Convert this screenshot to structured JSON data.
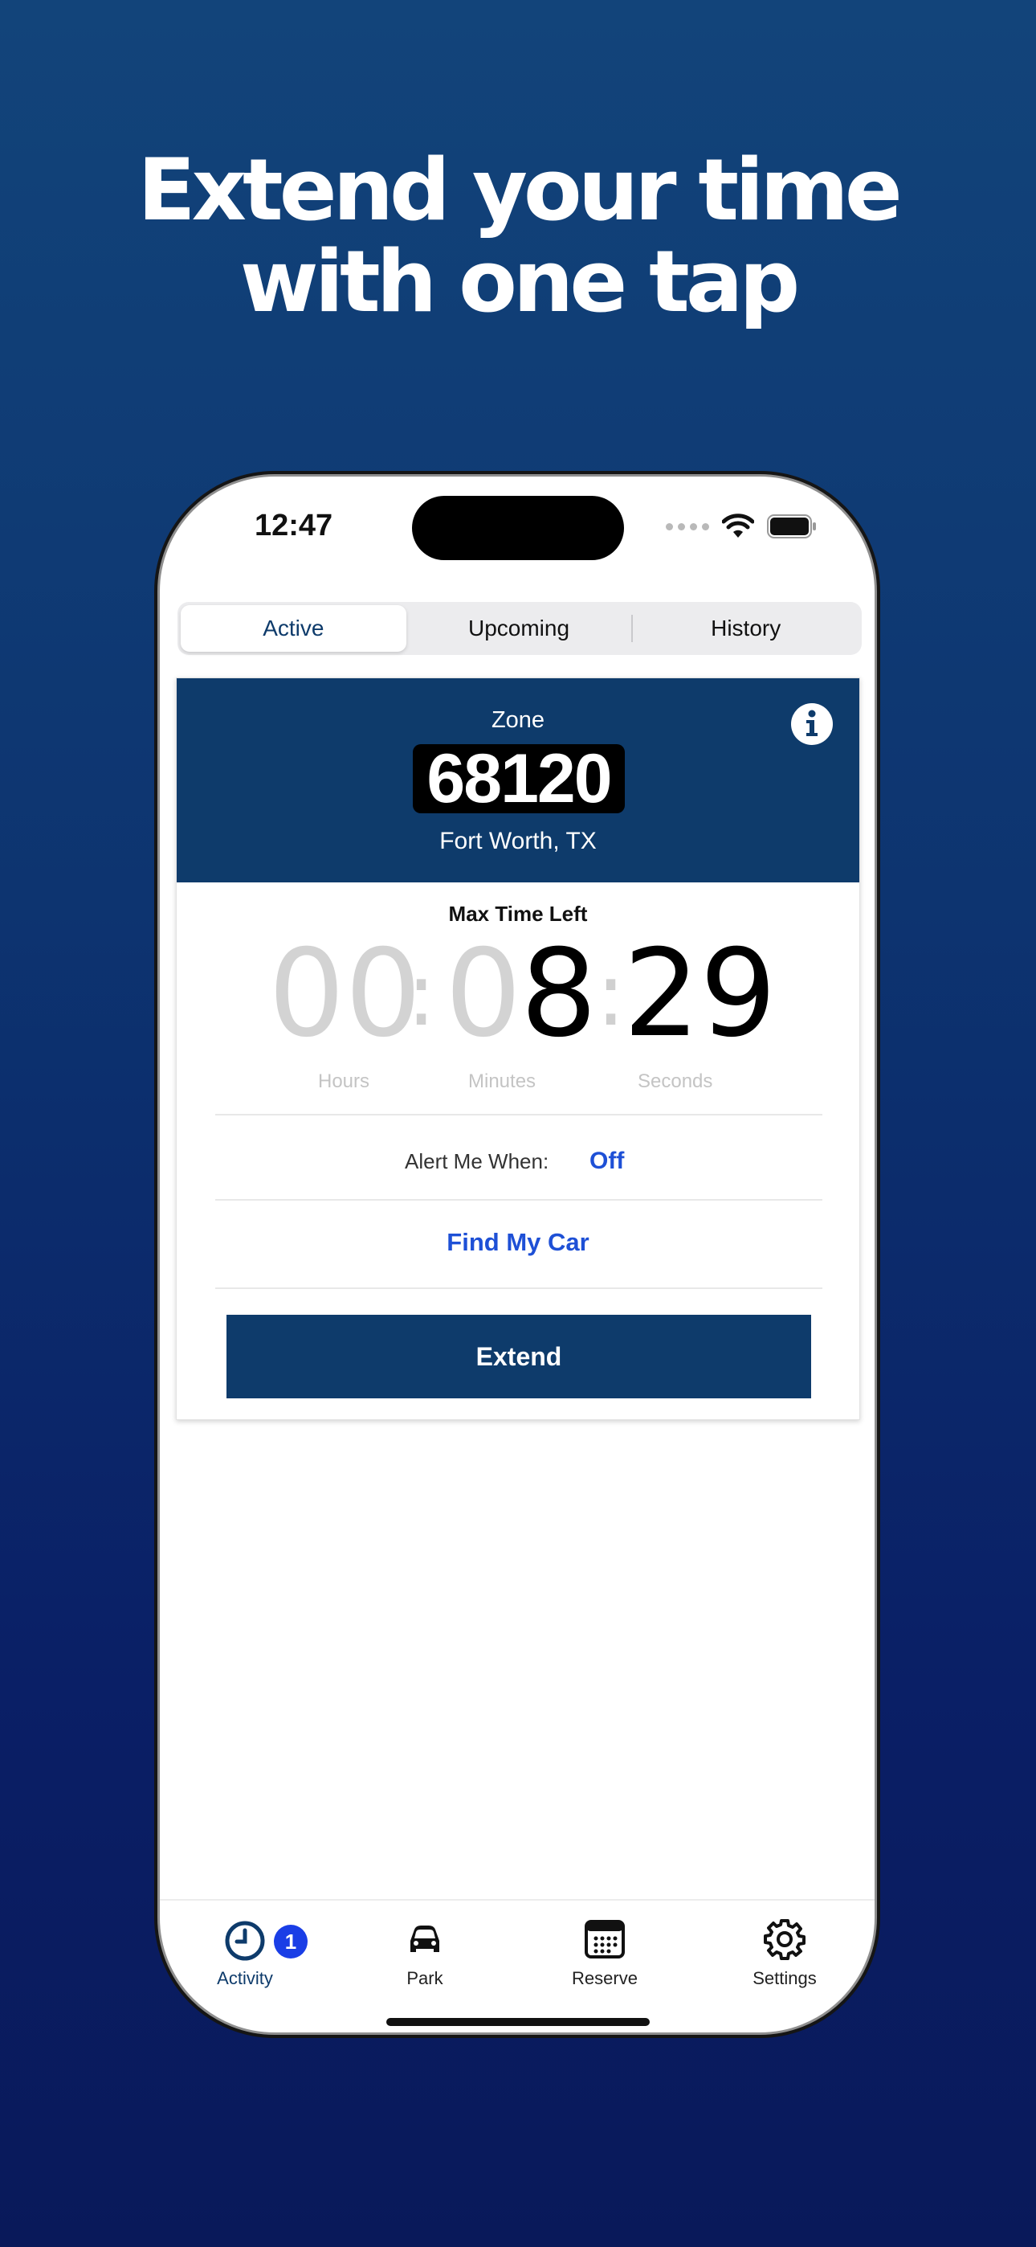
{
  "headline": {
    "line1": "Extend your time",
    "line2": "with one tap"
  },
  "status_bar": {
    "time": "12:47",
    "icons": [
      "signal-dots-icon",
      "wifi-icon",
      "battery-icon"
    ]
  },
  "segments": [
    {
      "label": "Active",
      "selected": true
    },
    {
      "label": "Upcoming",
      "selected": false
    },
    {
      "label": "History",
      "selected": false
    }
  ],
  "zone": {
    "label": "Zone",
    "number": "68120",
    "city": "Fort Worth, TX",
    "info_icon": "info-icon"
  },
  "timer": {
    "title": "Max Time Left",
    "hours": "00",
    "minutes_dim": "0",
    "minutes_active": "8",
    "seconds": "29",
    "units": {
      "hours": "Hours",
      "minutes": "Minutes",
      "seconds": "Seconds"
    }
  },
  "alert": {
    "label": "Alert Me When:",
    "value": "Off"
  },
  "find_car_label": "Find My Car",
  "extend_label": "Extend",
  "tabs": [
    {
      "label": "Activity",
      "icon": "clock-icon",
      "badge": "1",
      "active": true
    },
    {
      "label": "Park",
      "icon": "car-icon",
      "active": false
    },
    {
      "label": "Reserve",
      "icon": "calendar-icon",
      "active": false
    },
    {
      "label": "Settings",
      "icon": "gear-icon",
      "active": false
    }
  ],
  "colors": {
    "brand": "#0e3b6b",
    "link": "#1e50d6",
    "badge": "#1a3ee6"
  }
}
